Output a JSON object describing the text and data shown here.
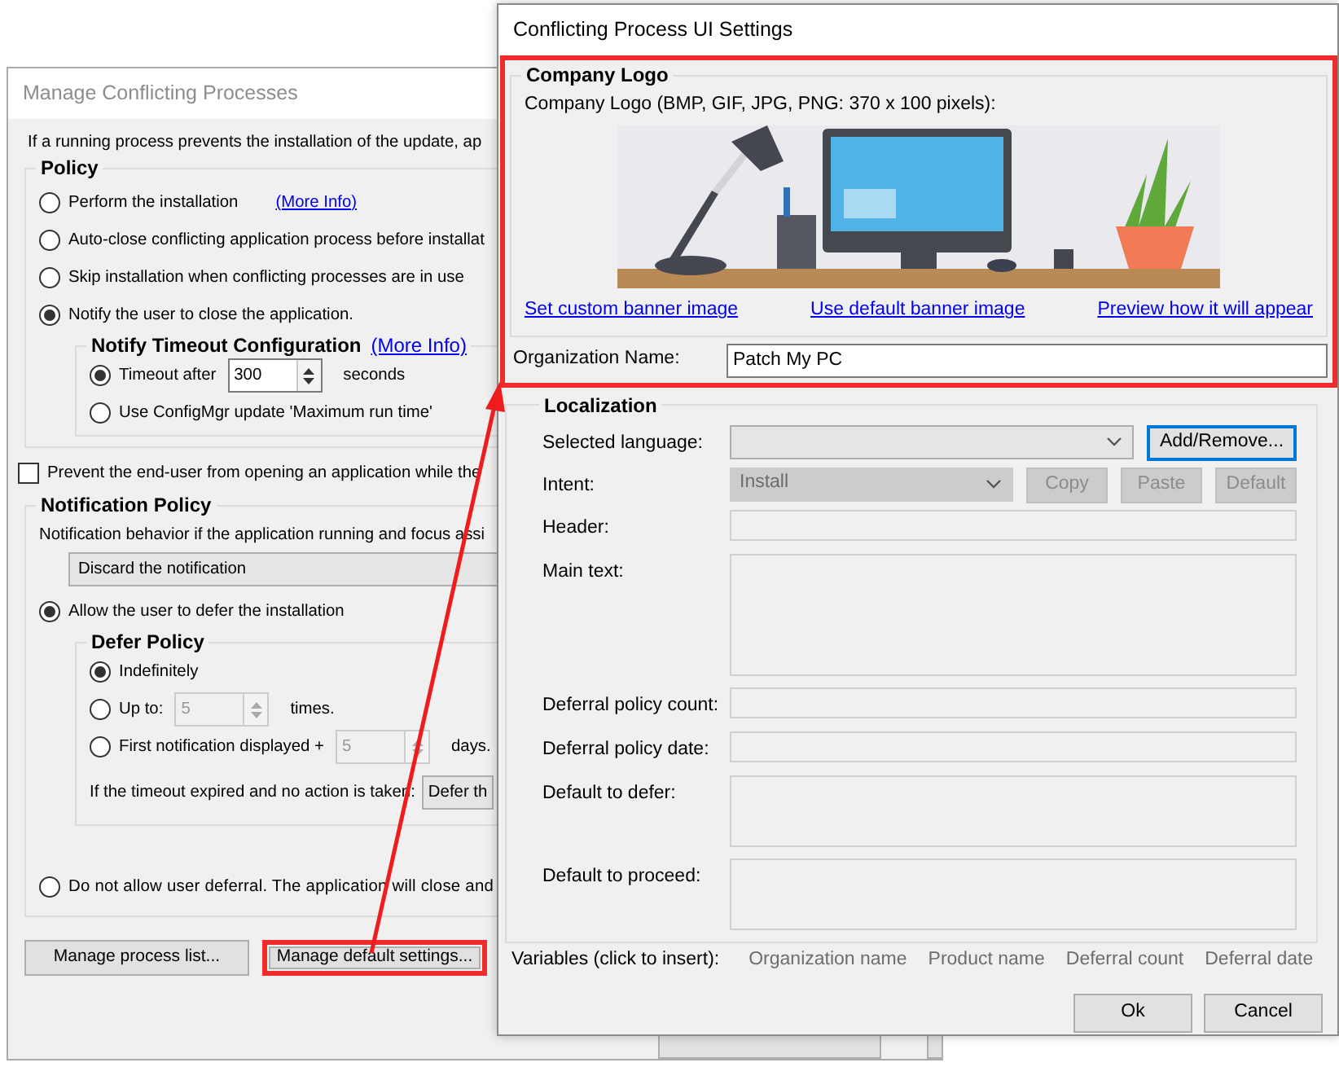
{
  "annotation": {
    "arrow": true
  },
  "back_window": {
    "title": "Manage Conflicting Processes",
    "intro": "If a running process prevents the installation of the update, ap",
    "policy": {
      "title": "Policy",
      "options": [
        {
          "label": "Perform the installation",
          "link": "(More Info)",
          "selected": false
        },
        {
          "label": "Auto-close conflicting application process before installat",
          "selected": false
        },
        {
          "label": "Skip installation when conflicting processes are in use",
          "selected": false
        },
        {
          "label": "Notify the user to close the application.",
          "selected": true
        }
      ]
    },
    "notify_timeout": {
      "title": "Notify Timeout Configuration",
      "link": "(More Info)",
      "options": [
        {
          "kind": "spinner",
          "label": "Timeout after",
          "value": "300",
          "unit": "seconds",
          "disabled": false,
          "selected": true
        },
        {
          "kind": "plain",
          "label": "Use ConfigMgr update 'Maximum run time'",
          "selected": false
        }
      ]
    },
    "prevent_checkbox": {
      "label": "Prevent the end-user from opening an application while the",
      "checked": false
    },
    "notification_policy": {
      "title": "Notification Policy",
      "description": "Notification behavior if the application running and focus assi",
      "dropdown": "Discard the notification",
      "allow_option": {
        "label": "Allow the user to defer the installation",
        "selected": true
      },
      "defer_policy": {
        "title": "Defer Policy",
        "options": [
          {
            "kind": "plain",
            "label": "Indefinitely",
            "selected": true
          },
          {
            "kind": "spinner",
            "label": "Up to:",
            "value": "5",
            "unit": "times.",
            "disabled": true,
            "selected": false
          },
          {
            "kind": "spinner",
            "label": "First notification displayed +",
            "value": "5",
            "unit": "days.",
            "disabled": true,
            "selected": false
          }
        ],
        "timeout_label": "If the timeout expired and no action is taken:",
        "timeout_dropdown": "Defer th"
      },
      "deny_option": {
        "label": "Do not allow user deferral. The application will close and",
        "selected": false
      }
    },
    "buttons": [
      {
        "label": "Manage process list...",
        "highlighted": false
      },
      {
        "label": "Manage default settings...",
        "highlighted": true
      }
    ]
  },
  "front_window": {
    "title": "Conflicting Process UI Settings",
    "highlighted": true,
    "company_logo": {
      "title": "Company Logo",
      "caption": "Company Logo (BMP, GIF, JPG, PNG: 370 x 100 pixels):",
      "banner": {
        "kind": "picture"
      },
      "links": [
        "Set custom banner image",
        "Use default banner image",
        "Preview how it will appear"
      ]
    },
    "organization": {
      "label": "Organization Name:",
      "value": "Patch My PC"
    },
    "localization": {
      "title": "Localization",
      "rows": [
        {
          "kind": "combo",
          "label": "Selected language:",
          "disabled": false,
          "buttons": [
            {
              "label": "Add/Remove...",
              "disabled": false,
              "focused": true
            }
          ]
        },
        {
          "kind": "combo",
          "label": "Intent:",
          "value": "Install",
          "disabled": true,
          "buttons": [
            {
              "label": "Copy",
              "disabled": true,
              "focused": false
            },
            {
              "label": "Paste",
              "disabled": true,
              "focused": false
            },
            {
              "label": "Default",
              "disabled": true,
              "focused": false
            }
          ]
        },
        {
          "kind": "line",
          "label": "Header:",
          "disabled": true
        },
        {
          "kind": "large-text",
          "label": "Main text:",
          "disabled": true
        },
        {
          "kind": "line",
          "label": "Deferral policy count:",
          "disabled": true
        },
        {
          "kind": "line",
          "label": "Deferral policy date:",
          "disabled": true
        },
        {
          "kind": "text",
          "label": "Default to defer:",
          "disabled": true
        },
        {
          "kind": "text",
          "label": "Default to proceed:",
          "disabled": true
        }
      ]
    },
    "variables": {
      "label": "Variables (click to insert):",
      "items": [
        {
          "label": "Organization name",
          "disabled": true
        },
        {
          "label": "Product name",
          "disabled": true
        },
        {
          "label": "Deferral count",
          "disabled": true
        },
        {
          "label": "Deferral date",
          "disabled": true
        }
      ]
    },
    "buttons": [
      "Ok",
      "Cancel"
    ]
  }
}
